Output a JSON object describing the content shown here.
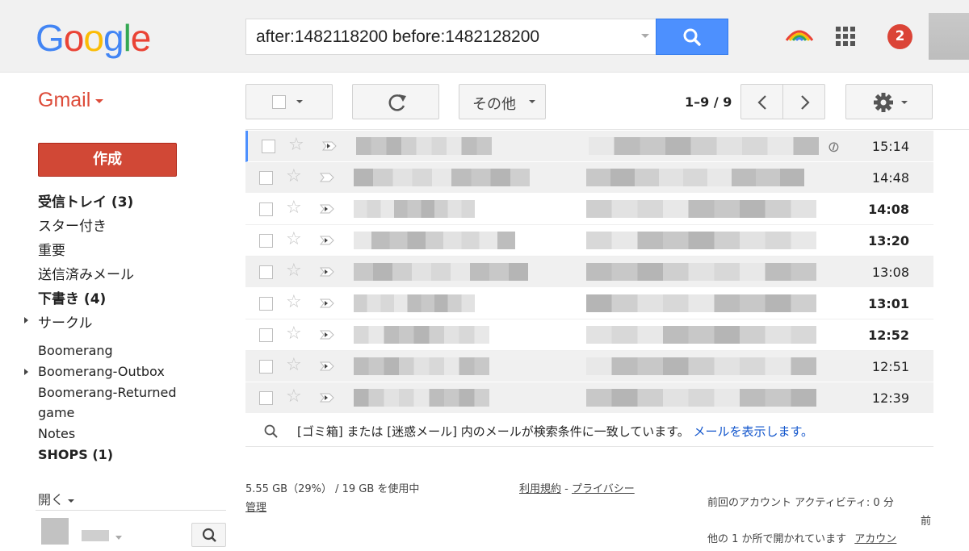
{
  "header": {
    "logo_letters": [
      "G",
      "o",
      "o",
      "g",
      "l",
      "e"
    ],
    "logo_colors": [
      "#4285f4",
      "#ea4335",
      "#fbbc05",
      "#4285f4",
      "#34a853",
      "#ea4335"
    ],
    "search_query": "after:1482118200 before:1482128200",
    "notification_count": "2"
  },
  "toolbar": {
    "app_label": "Gmail",
    "more_label": "その他",
    "page_count": "1–9 / 9"
  },
  "sidebar": {
    "compose_label": "作成",
    "items": [
      {
        "label": "受信トレイ (3)",
        "bold": true
      },
      {
        "label": "スター付き",
        "bold": false
      },
      {
        "label": "重要",
        "bold": false
      },
      {
        "label": "送信済みメール",
        "bold": false
      },
      {
        "label": "下書き (4)",
        "bold": true
      },
      {
        "label": "サークル",
        "bold": false
      }
    ],
    "labels": [
      {
        "label": "Boomerang"
      },
      {
        "label": "Boomerang-Outbox"
      },
      {
        "label": "Boomerang-Returned"
      },
      {
        "label": "game"
      },
      {
        "label": "Notes"
      },
      {
        "label": "SHOPS (1)"
      }
    ],
    "more_label": "開く"
  },
  "messages": [
    {
      "time": "15:14",
      "unread": false,
      "attachment": true
    },
    {
      "time": "14:48",
      "unread": false,
      "attachment": false
    },
    {
      "time": "14:08",
      "unread": true,
      "attachment": false
    },
    {
      "time": "13:20",
      "unread": true,
      "attachment": false
    },
    {
      "time": "13:08",
      "unread": false,
      "attachment": false
    },
    {
      "time": "13:01",
      "unread": true,
      "attachment": false
    },
    {
      "time": "12:52",
      "unread": true,
      "attachment": false
    },
    {
      "time": "12:51",
      "unread": false,
      "attachment": false
    },
    {
      "time": "12:39",
      "unread": false,
      "attachment": false
    }
  ],
  "trash_note": {
    "text": "[ゴミ箱] または [迷惑メール] 内のメールが検索条件に一致しています。",
    "link": "メールを表示します。"
  },
  "footer": {
    "storage": "5.55 GB（29%） / 19 GB を使用中",
    "manage": "管理",
    "terms": "利用規約",
    "separator": " - ",
    "privacy": "プライバシー",
    "activity_line1": "前回のアカウント アクティビティ: 0 分",
    "activity_line2": "前",
    "activity_line3": "他の 1 か所で開かれています",
    "details_link": "アカウン"
  },
  "colors": {
    "accent": "#4d90fe",
    "compose": "#d14836",
    "gmail_red": "#dd4b39"
  }
}
